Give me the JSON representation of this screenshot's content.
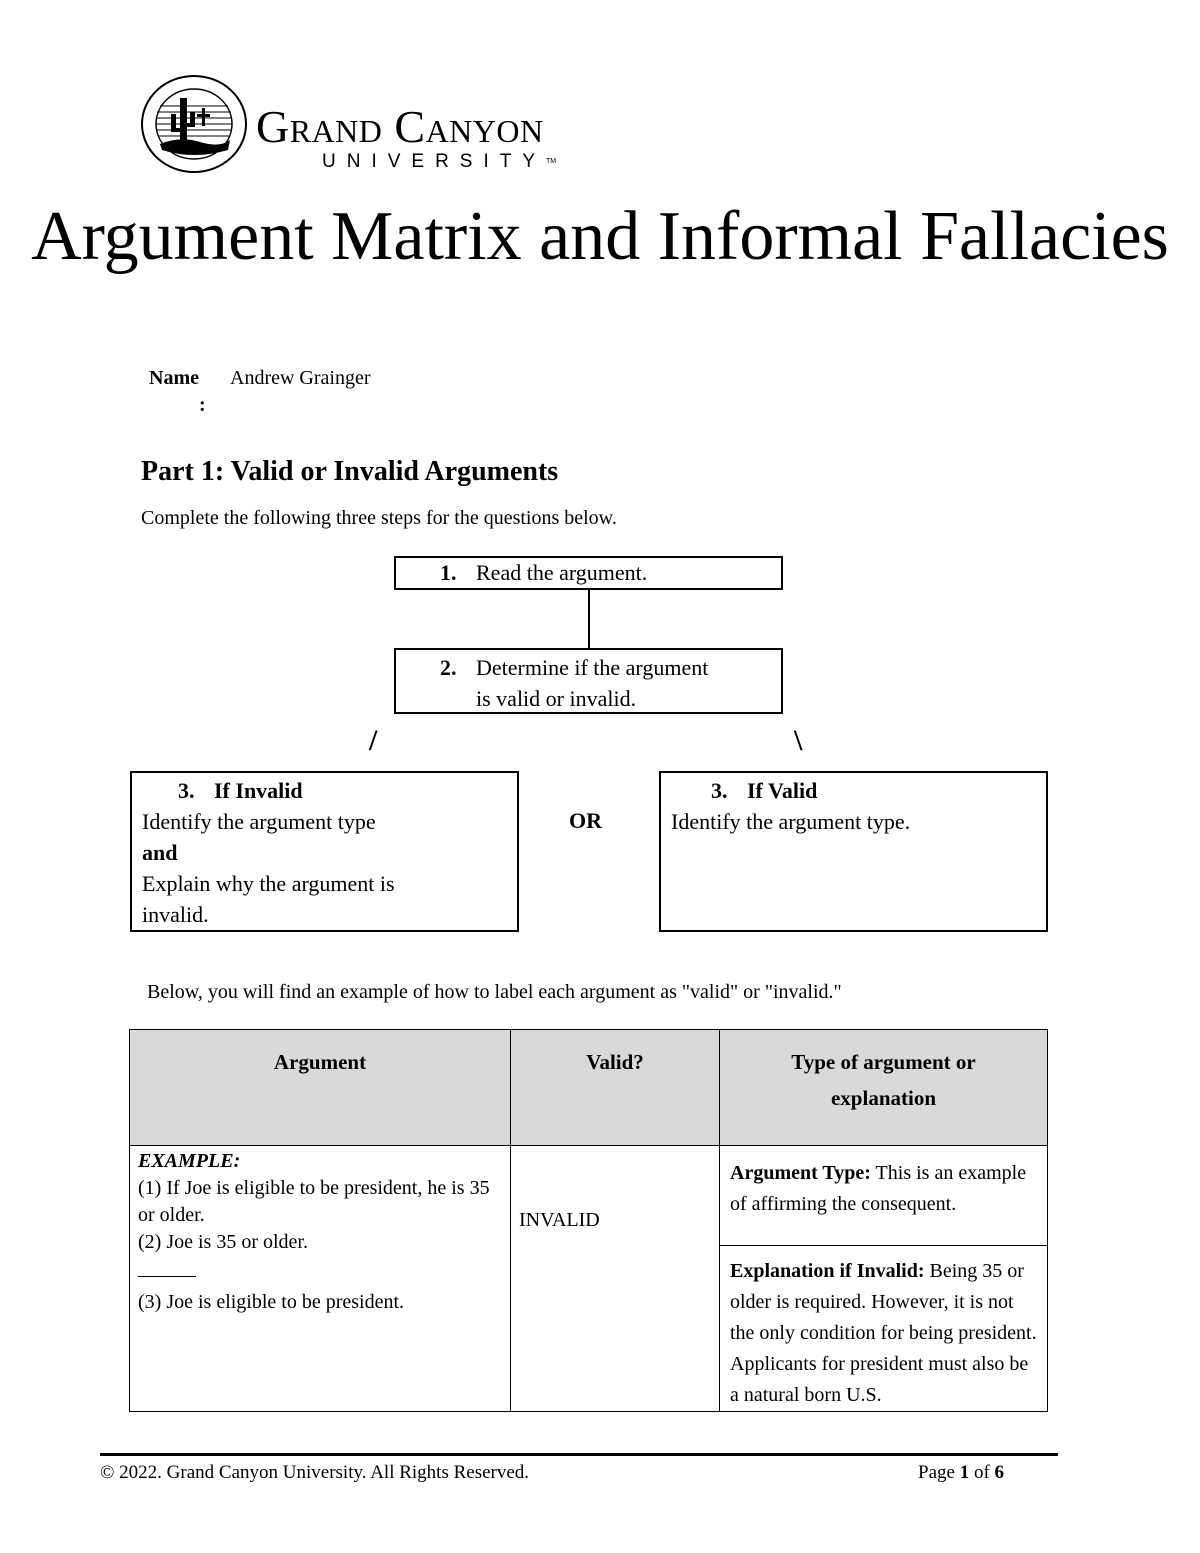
{
  "header": {
    "logo": {
      "seal_icon": "university-seal-icon",
      "wordmark": "Grand Canyon",
      "subtitle": "UNIVERSITY",
      "trademark": "TM"
    },
    "title": "Argument Matrix and Informal Fallacies"
  },
  "student": {
    "name_label": "Name",
    "colon": ":",
    "name_value": "Andrew Grainger"
  },
  "part1": {
    "heading": "Part 1: Valid or Invalid Arguments",
    "instructions": "Complete the following three steps for the questions below.",
    "flowchart": {
      "step1": {
        "number": "1.",
        "text": "Read the argument."
      },
      "step2": {
        "number": "2.",
        "line1": "Determine if the argument",
        "line2": "is valid or invalid."
      },
      "left_connector": "/",
      "right_connector": "\\",
      "step3_invalid": {
        "number": "3.",
        "title": "If Invalid",
        "line1": "Identify the argument type",
        "line2": "and",
        "line3": "Explain why the argument is",
        "line4": "invalid."
      },
      "or_label": "OR",
      "step3_valid": {
        "number": "3.",
        "title": "If Valid",
        "line1": "Identify the argument type."
      }
    },
    "example_intro": "Below, you will find an example of how to label each argument as \"valid\" or \"invalid.\"",
    "table": {
      "headers": [
        "Argument",
        "Valid?",
        "Type of argument or explanation"
      ],
      "example": {
        "label": "EXAMPLE:",
        "premise1": "(1) If Joe is eligible to be president, he is 35 or older.",
        "premise2": "(2) Joe is 35 or older.",
        "conclusion": "(3) Joe is eligible to be president.",
        "valid": "INVALID",
        "type_label": "Argument Type:",
        "type_text": " This is an example of affirming the consequent.",
        "explanation_label": "Explanation if Invalid:",
        "explanation_text": " Being 35 or older is required. However, it is not the only condition for being president. Applicants for president must also be a natural born U.S."
      }
    }
  },
  "footer": {
    "copyright": "© 2022. Grand Canyon University. All Rights Reserved.",
    "page_prefix": "Page ",
    "page_current": "1",
    "page_of": " of ",
    "page_total": "6"
  }
}
